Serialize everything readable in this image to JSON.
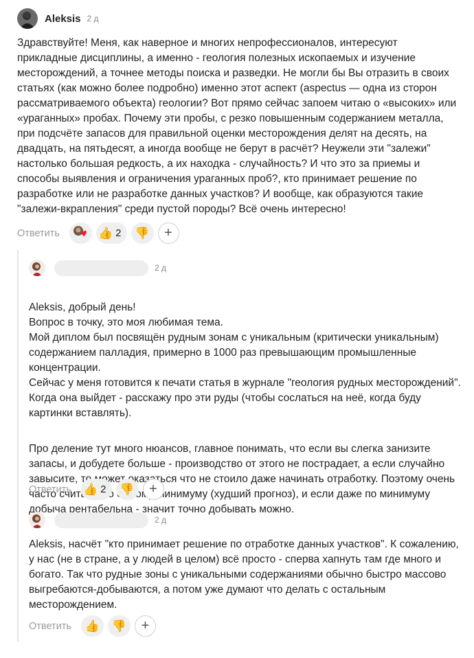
{
  "comments": [
    {
      "author": "Aleksis",
      "date": "2 д",
      "paragraphs": [
        "Здравствуйте! Меня, как наверное и многих непрофессионалов, интересуют прикладные дисциплины, а именно - геология полезных ископаемых и изучение месторождений, а точнее методы поиска и разведки. Не могли бы Вы отразить в своих статьях (как можно более подробно) именно этот аспект (aspectus — одна из сторон рассматриваемого объекта) геологии? Вот прямо сейчас запоем читаю о «высоких» или «ураганных» пробах. Почему эти пробы, с резко повышенным содержанием металла, при подсчёте запасов для правильной оценки месторождения делят на десять, на двадцать, на пятьдесят, а иногда вообще не берут в расчёт? Неужели эти \"залежи\" настолько большая редкость, а их находка - случайность? И что это за приемы и способы выявления и ограничения ураганных проб?, кто принимает решение по разработке или не разработке данных участков? И вообще, как образуются такие \"залежи-вкрапления\" среди пустой породы? Всё очень интересно!"
      ],
      "reply_label": "Ответить",
      "like_count": "2"
    },
    {
      "author": "",
      "date": "2 д",
      "paragraphs": [
        "Aleksis, добрый день!\nВопрос в точку, это моя любимая тема.\nМой диплом был посвящён рудным зонам с уникальным (критически уникальным) содержанием палладия, примерно в 1000 раз превышающим промышленные концентрации.\nСейчас у меня готовится к печати статья в журнале \"геология рудных месторождений\". Когда она выйдет - расскажу про эти руды (чтобы сослаться на неё, когда буду картинки вставлять).",
        "Про деление тут много нюансов, главное понимать, что если вы слегка занизите запасы, и добудете больше - производство от этого не пострадает, а если случайно завысите, то может оказаться что не стоило даже начинать отработку. Поэтому очень часто считают по самому минимуму (худший прогноз), и если даже по минимуму добыча рентабельна - значит точно добывать можно."
      ],
      "reply_label": "Ответить",
      "like_count": "2"
    },
    {
      "author": "",
      "date": "2 д",
      "paragraphs": [
        "Aleksis, насчёт \"кто принимает решение по отработке данных участков\". К сожалению, у нас (не в стране, а у людей в целом) всё просто - сперва хапнуть там где много и богато. Так что рудные зоны с уникальными содержаниями обычно быстро массово выгребаются-добываются, а потом уже думают что делать с остальным месторождением."
      ],
      "reply_label": "Ответить",
      "like_count": ""
    }
  ],
  "icons": {
    "like": "thumbs-up-icon",
    "dislike": "thumbs-down-icon",
    "add_reaction": "plus-icon",
    "heart_reaction": "heart-reaction-icon"
  },
  "plus_symbol": "+"
}
